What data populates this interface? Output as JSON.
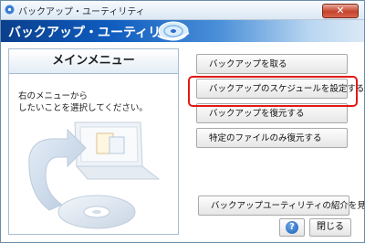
{
  "window": {
    "title": "バックアップ・ユーティリティ",
    "close_glyph": "✕"
  },
  "banner": {
    "title": "バックアップ・ユーティリティ"
  },
  "left_panel": {
    "header": "メインメニュー",
    "description_line1": "右のメニューから",
    "description_line2": "したいことを選択してください。"
  },
  "menu": {
    "backup": "バックアップを取る",
    "schedule": "バックアップのスケジュールを設定する",
    "restore": "バックアップを復元する",
    "restore_specific": "特定のファイルのみ復元する",
    "intro": "バックアップユーティリティの紹介を見る"
  },
  "footer": {
    "help_glyph": "?",
    "close": "閉じる"
  },
  "colors": {
    "highlight": "#e11a16",
    "banner": "#0f5cbf"
  }
}
